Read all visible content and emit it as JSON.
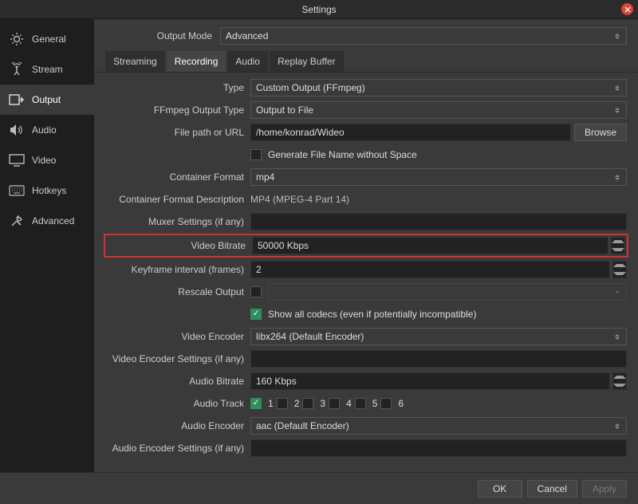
{
  "window_title": "Settings",
  "sidebar": {
    "items": [
      {
        "label": "General"
      },
      {
        "label": "Stream"
      },
      {
        "label": "Output"
      },
      {
        "label": "Audio"
      },
      {
        "label": "Video"
      },
      {
        "label": "Hotkeys"
      },
      {
        "label": "Advanced"
      }
    ]
  },
  "output_mode": {
    "label": "Output Mode",
    "value": "Advanced"
  },
  "tabs": [
    {
      "label": "Streaming"
    },
    {
      "label": "Recording"
    },
    {
      "label": "Audio"
    },
    {
      "label": "Replay Buffer"
    }
  ],
  "form": {
    "type": {
      "label": "Type",
      "value": "Custom Output (FFmpeg)"
    },
    "ffmpeg_type": {
      "label": "FFmpeg Output Type",
      "value": "Output to File"
    },
    "file_path": {
      "label": "File path or URL",
      "value": "/home/konrad/Wideo",
      "browse": "Browse"
    },
    "gen_filename": {
      "label": "Generate File Name without Space",
      "checked": false
    },
    "container": {
      "label": "Container Format",
      "value": "mp4"
    },
    "container_desc": {
      "label": "Container Format Description",
      "value": "MP4 (MPEG-4 Part 14)"
    },
    "muxer": {
      "label": "Muxer Settings (if any)",
      "value": ""
    },
    "video_bitrate": {
      "label": "Video Bitrate",
      "value": "50000 Kbps"
    },
    "keyframe": {
      "label": "Keyframe interval (frames)",
      "value": "2"
    },
    "rescale": {
      "label": "Rescale Output",
      "checked": false,
      "value": ""
    },
    "show_all": {
      "label": "Show all codecs (even if potentially incompatible)",
      "checked": true
    },
    "venc": {
      "label": "Video Encoder",
      "value": "libx264 (Default Encoder)"
    },
    "venc_set": {
      "label": "Video Encoder Settings (if any)",
      "value": ""
    },
    "audio_bitrate": {
      "label": "Audio Bitrate",
      "value": "160 Kbps"
    },
    "atrack": {
      "label": "Audio Track",
      "tracks": [
        "1",
        "2",
        "3",
        "4",
        "5",
        "6"
      ],
      "checked": [
        true,
        false,
        false,
        false,
        false,
        false
      ]
    },
    "aenc": {
      "label": "Audio Encoder",
      "value": "aac (Default Encoder)"
    },
    "aenc_set": {
      "label": "Audio Encoder Settings (if any)",
      "value": ""
    }
  },
  "footer": {
    "ok": "OK",
    "cancel": "Cancel",
    "apply": "Apply"
  }
}
